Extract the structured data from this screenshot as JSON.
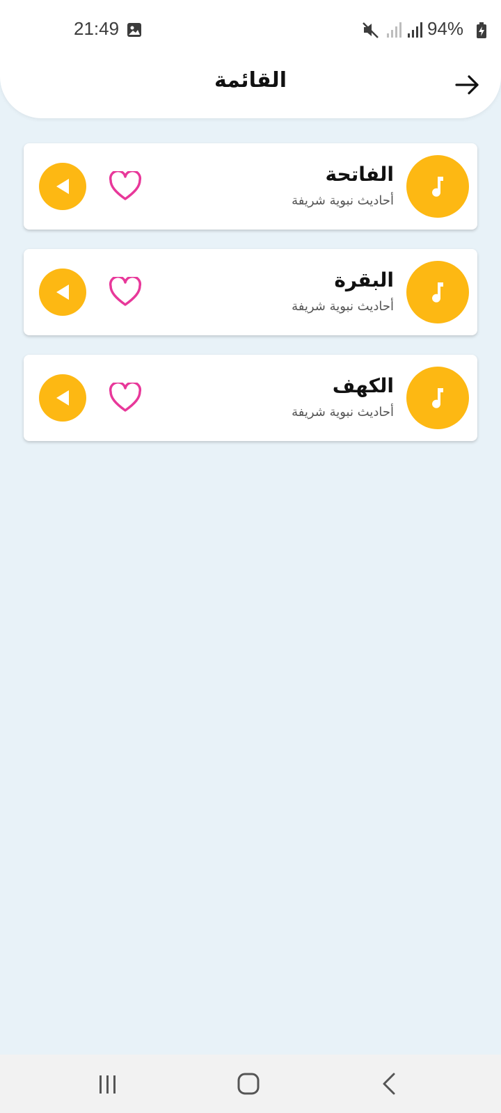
{
  "status_bar": {
    "time": "21:49",
    "battery": "94%",
    "icons": [
      "image-icon",
      "mute-icon",
      "signal-icon",
      "signal-icon",
      "battery-charging-icon"
    ]
  },
  "header": {
    "title": "القائمة",
    "back_icon": "arrow-right-icon"
  },
  "items": [
    {
      "title": "الفاتحة",
      "subtitle": "أحاديث نبوية شريفة"
    },
    {
      "title": "البقرة",
      "subtitle": "أحاديث نبوية شريفة"
    },
    {
      "title": "الكهف",
      "subtitle": "أحاديث نبوية شريفة"
    }
  ],
  "colors": {
    "accent": "#fdb813",
    "heart": "#e8389a",
    "background": "#e8f2f8",
    "card": "#ffffff"
  },
  "nav": {
    "icons": [
      "recent-apps-icon",
      "home-icon",
      "back-icon"
    ]
  }
}
